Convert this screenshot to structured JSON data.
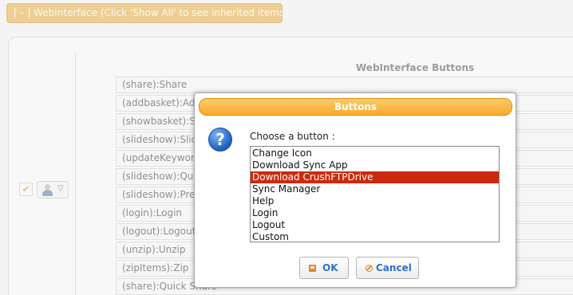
{
  "background": {
    "section_toggle": "[ - ] WebInterface (Click 'Show All' to see inherited items.)",
    "heading": "WebInterface Buttons",
    "check_mark": "✔",
    "rows": [
      "(share):Share",
      "(addbasket):Add",
      "(showbasket):Sh",
      "(slideshow):Slid",
      "(updateKeyword",
      "(slideshow):Quic",
      "(slideshow):Prev",
      "(login):Login",
      "(logout):Logout",
      "(unzip):Unzip",
      "(zipItems):Zip",
      "(share):Quick Share"
    ]
  },
  "dialog": {
    "title": "Buttons",
    "help_glyph": "?",
    "prompt": "Choose a button :",
    "options": [
      "Change Icon",
      "Download Sync App",
      "Download CrushFTPDrive",
      "Sync Manager",
      "Help",
      "Login",
      "Logout",
      "Custom"
    ],
    "selected_option": "Download CrushFTPDrive",
    "ok_label": "OK",
    "cancel_label": "Cancel"
  },
  "colors": {
    "accent_orange": "#f7ab2d",
    "selection_red": "#cc2a0e",
    "link_blue": "#2f72c4"
  }
}
